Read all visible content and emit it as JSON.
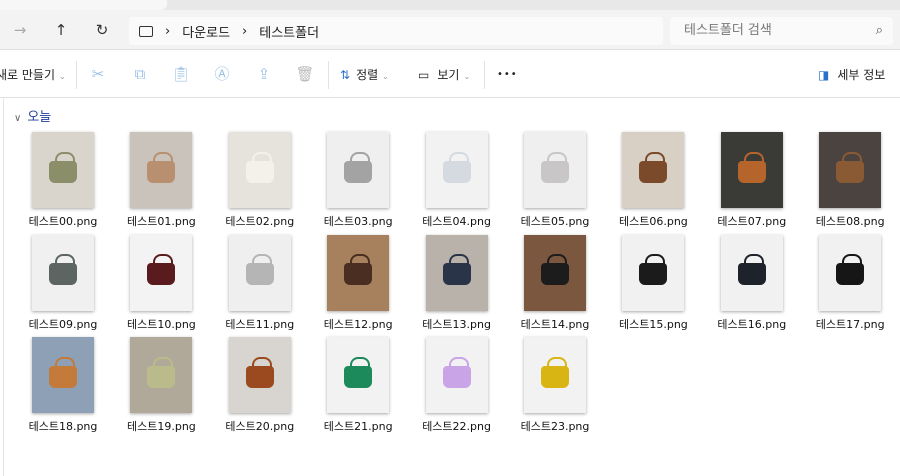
{
  "nav": {
    "back": "←",
    "forward": "→",
    "up": "↑",
    "refresh": "↻"
  },
  "breadcrumb": [
    "다운로드",
    "테스트폴더"
  ],
  "search": {
    "placeholder": "테스트폴더 검색"
  },
  "toolbar": {
    "new_label": "새로 만들기",
    "sort_label": "정렬",
    "view_label": "보기",
    "more": "•••",
    "details_label": "세부 정보"
  },
  "group": {
    "label": "오늘"
  },
  "files": [
    {
      "name": "테스트00.png",
      "bg": "#d9d4cc",
      "bag": "#8a8f6a"
    },
    {
      "name": "테스트01.png",
      "bg": "#c9c3bc",
      "bag": "#b89070"
    },
    {
      "name": "테스트02.png",
      "bg": "#e6e2dc",
      "bag": "#f4f1ea"
    },
    {
      "name": "테스트03.png",
      "bg": "#efefef",
      "bag": "#a3a3a3"
    },
    {
      "name": "테스트04.png",
      "bg": "#f2f2f2",
      "bag": "#d5dae0"
    },
    {
      "name": "테스트05.png",
      "bg": "#efefef",
      "bag": "#c8c6c6"
    },
    {
      "name": "테스트06.png",
      "bg": "#d8d0c4",
      "bag": "#7a4a2a"
    },
    {
      "name": "테스트07.png",
      "bg": "#3a3a36",
      "bag": "#b5652b"
    },
    {
      "name": "테스트08.png",
      "bg": "#4a4340",
      "bag": "#8a5a34"
    },
    {
      "name": "테스트09.png",
      "bg": "#f0f0f0",
      "bag": "#5d6562"
    },
    {
      "name": "테스트10.png",
      "bg": "#f3f3f3",
      "bag": "#5a1b1e"
    },
    {
      "name": "테스트11.png",
      "bg": "#efefef",
      "bag": "#b5b5b5"
    },
    {
      "name": "테스트12.png",
      "bg": "#a7805e",
      "bag": "#4a2e22"
    },
    {
      "name": "테스트13.png",
      "bg": "#b8b2ab",
      "bag": "#2a3448"
    },
    {
      "name": "테스트14.png",
      "bg": "#7c5740",
      "bag": "#1c1c1c"
    },
    {
      "name": "테스트15.png",
      "bg": "#f1f1f1",
      "bag": "#1b1b1b"
    },
    {
      "name": "테스트16.png",
      "bg": "#f1f1f1",
      "bag": "#1e222a"
    },
    {
      "name": "테스트17.png",
      "bg": "#f1f1f1",
      "bag": "#161616"
    },
    {
      "name": "테스트18.png",
      "bg": "#8ea0b5",
      "bag": "#c47a3a"
    },
    {
      "name": "테스트19.png",
      "bg": "#b0a898",
      "bag": "#b9bb8a"
    },
    {
      "name": "테스트20.png",
      "bg": "#d8d4cf",
      "bag": "#9a4a1e"
    },
    {
      "name": "테스트21.png",
      "bg": "#f2f2f2",
      "bag": "#1c8a5a"
    },
    {
      "name": "테스트22.png",
      "bg": "#f2f2f2",
      "bag": "#c9a4e6"
    },
    {
      "name": "테스트23.png",
      "bg": "#f2f2f2",
      "bag": "#d9b514"
    }
  ]
}
